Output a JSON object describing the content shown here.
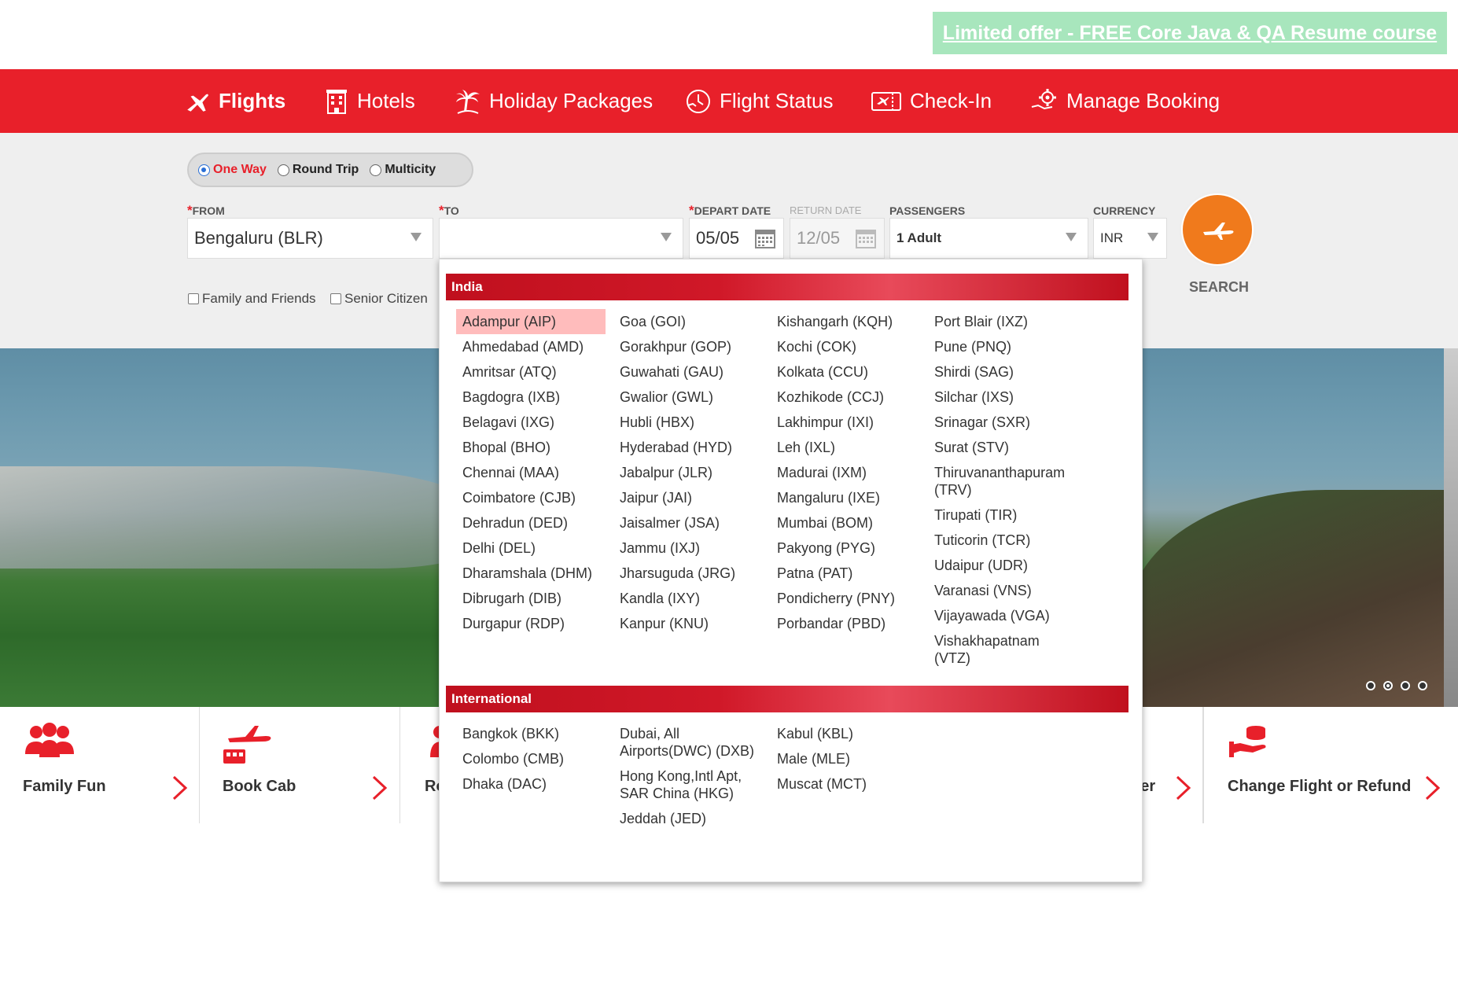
{
  "promo": {
    "text": "Limited offer - FREE Core Java & QA Resume course"
  },
  "nav": {
    "items": [
      {
        "label": "Flights"
      },
      {
        "label": "Hotels"
      },
      {
        "label": "Holiday Packages"
      },
      {
        "label": "Flight Status"
      },
      {
        "label": "Check-In"
      },
      {
        "label": "Manage Booking"
      }
    ]
  },
  "trip": {
    "one_way": "One Way",
    "round_trip": "Round Trip",
    "multicity": "Multicity",
    "selected": "One Way"
  },
  "form": {
    "from_label": "FROM",
    "from_value": "Bengaluru (BLR)",
    "to_label": "TO",
    "to_value": "",
    "depart_label": "DEPART DATE",
    "depart_value": "05/05",
    "return_label": "RETURN DATE",
    "return_value": "12/05",
    "passengers_label": "PASSENGERS",
    "passengers_value": "1 Adult",
    "currency_label": "CURRENCY",
    "currency_value": "INR",
    "search_label": "SEARCH",
    "family_label": "Family and Friends",
    "senior_label": "Senior Citizen",
    "required_mark": "*"
  },
  "features": [
    {
      "label": "Family Fun"
    },
    {
      "label": "Book Cab"
    },
    {
      "label": "Ro"
    },
    {
      "label": "eller"
    },
    {
      "label": "Change Flight or Refund"
    }
  ],
  "dropdown": {
    "india_header": "India",
    "india_columns": [
      [
        "Adampur (AIP)",
        "Ahmedabad (AMD)",
        "Amritsar (ATQ)",
        "Bagdogra (IXB)",
        "Belagavi (IXG)",
        "Bhopal (BHO)",
        "Chennai (MAA)",
        "Coimbatore (CJB)",
        "Dehradun (DED)",
        "Delhi (DEL)",
        "Dharamshala (DHM)",
        "Dibrugarh (DIB)",
        "Durgapur (RDP)"
      ],
      [
        "Goa (GOI)",
        "Gorakhpur (GOP)",
        "Guwahati (GAU)",
        "Gwalior (GWL)",
        "Hubli (HBX)",
        "Hyderabad (HYD)",
        "Jabalpur (JLR)",
        "Jaipur (JAI)",
        "Jaisalmer (JSA)",
        "Jammu (IXJ)",
        "Jharsuguda (JRG)",
        "Kandla (IXY)",
        "Kanpur (KNU)"
      ],
      [
        "Kishangarh (KQH)",
        "Kochi (COK)",
        "Kolkata (CCU)",
        "Kozhikode (CCJ)",
        "Lakhimpur (IXI)",
        "Leh (IXL)",
        "Madurai (IXM)",
        "Mangaluru (IXE)",
        "Mumbai (BOM)",
        "Pakyong (PYG)",
        "Patna (PAT)",
        "Pondicherry (PNY)",
        "Porbandar (PBD)"
      ],
      [
        "Port Blair (IXZ)",
        "Pune (PNQ)",
        "Shirdi (SAG)",
        "Silchar (IXS)",
        "Srinagar (SXR)",
        "Surat (STV)",
        "Thiruvananthapuram (TRV)",
        "Tirupati (TIR)",
        "Tuticorin (TCR)",
        "Udaipur (UDR)",
        "Varanasi (VNS)",
        "Vijayawada (VGA)",
        "Vishakhapatnam (VTZ)"
      ]
    ],
    "highlighted": "Adampur (AIP)",
    "intl_header": "International",
    "intl_columns": [
      [
        "Bangkok (BKK)",
        "Colombo (CMB)",
        "Dhaka (DAC)"
      ],
      [
        "Dubai, All Airports(DWC) (DXB)",
        "Hong Kong,Intl Apt, SAR China (HKG)",
        "Jeddah (JED)"
      ],
      [
        "Kabul (KBL)",
        "Male (MLE)",
        "Muscat (MCT)"
      ]
    ]
  },
  "carousel": {
    "slides": 4,
    "active": 2
  },
  "colors": {
    "brand_red": "#e8202a",
    "search_orange": "#f07a1c",
    "promo_green": "#a8e6bd",
    "highlight": "#ffbcbc"
  }
}
